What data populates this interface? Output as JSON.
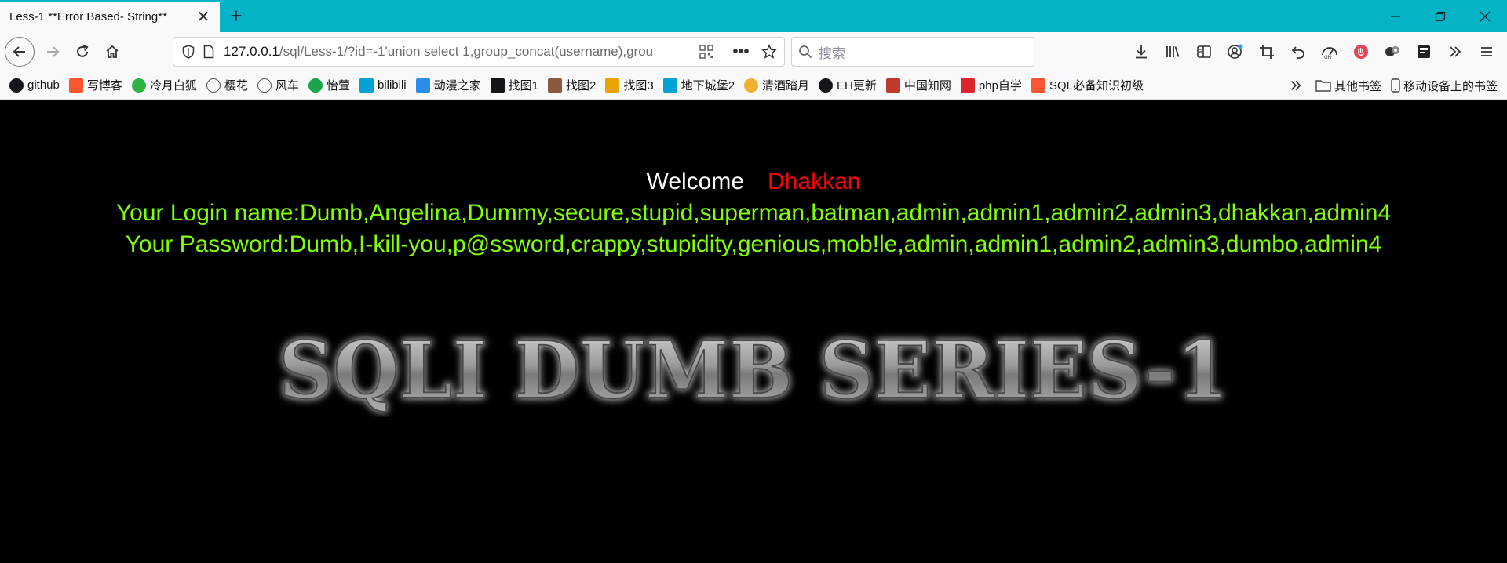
{
  "tab": {
    "title": "Less-1 **Error Based- String**"
  },
  "url": {
    "host": "127.0.0.1",
    "path": "/sql/Less-1/?id=-1'union select 1,group_concat(username),grou"
  },
  "search": {
    "placeholder": "搜索"
  },
  "bookmarks": [
    {
      "label": "github",
      "icon": "github-icon",
      "color": "#15141a"
    },
    {
      "label": "写博客",
      "icon": "csdn-icon",
      "color": "#fc5531"
    },
    {
      "label": "冷月白狐",
      "icon": "leaf-icon",
      "color": "#2fb344"
    },
    {
      "label": "樱花",
      "icon": "globe-icon",
      "color": "#555555"
    },
    {
      "label": "风车",
      "icon": "globe-icon",
      "color": "#555555"
    },
    {
      "label": "怡萱",
      "icon": "leaf-icon",
      "color": "#1aa34a"
    },
    {
      "label": "bilibili",
      "icon": "bilibili-icon",
      "color": "#00a1d6"
    },
    {
      "label": "动漫之家",
      "icon": "dmzj-icon",
      "color": "#2a8ee8"
    },
    {
      "label": "找图1",
      "icon": "x-icon",
      "color": "#15141a"
    },
    {
      "label": "找图2",
      "icon": "avatar-icon",
      "color": "#8a5a3c"
    },
    {
      "label": "找图3",
      "icon": "image-icon",
      "color": "#e8a400"
    },
    {
      "label": "地下城堡2",
      "icon": "bilibili-icon",
      "color": "#00a1d6"
    },
    {
      "label": "清酒踏月",
      "icon": "moon-icon",
      "color": "#f0b030"
    },
    {
      "label": "EH更新",
      "icon": "github-icon",
      "color": "#15141a"
    },
    {
      "label": "中国知网",
      "icon": "cnki-icon",
      "color": "#c0392b"
    },
    {
      "label": "php自学",
      "icon": "php-icon",
      "color": "#d9252b"
    },
    {
      "label": "SQL必备知识初级",
      "icon": "csdn-icon",
      "color": "#fc5531"
    }
  ],
  "bookmarks_right": {
    "other": "其他书签",
    "mobile": "移动设备上的书签"
  },
  "content": {
    "welcome": "Welcome",
    "name": "Dhakkan",
    "login_line": "Your Login name:Dumb,Angelina,Dummy,secure,stupid,superman,batman,admin,admin1,admin2,admin3,dhakkan,admin4",
    "password_line": "Your Password:Dumb,I-kill-you,p@ssword,crappy,stupidity,genious,mob!le,admin,admin1,admin2,admin3,dumbo,admin4",
    "banner": "SQLI DUMB SERIES-1"
  },
  "colors": {
    "tabbar": "#05b3c6",
    "login_text": "#7fff00",
    "name": "#ff0000"
  }
}
